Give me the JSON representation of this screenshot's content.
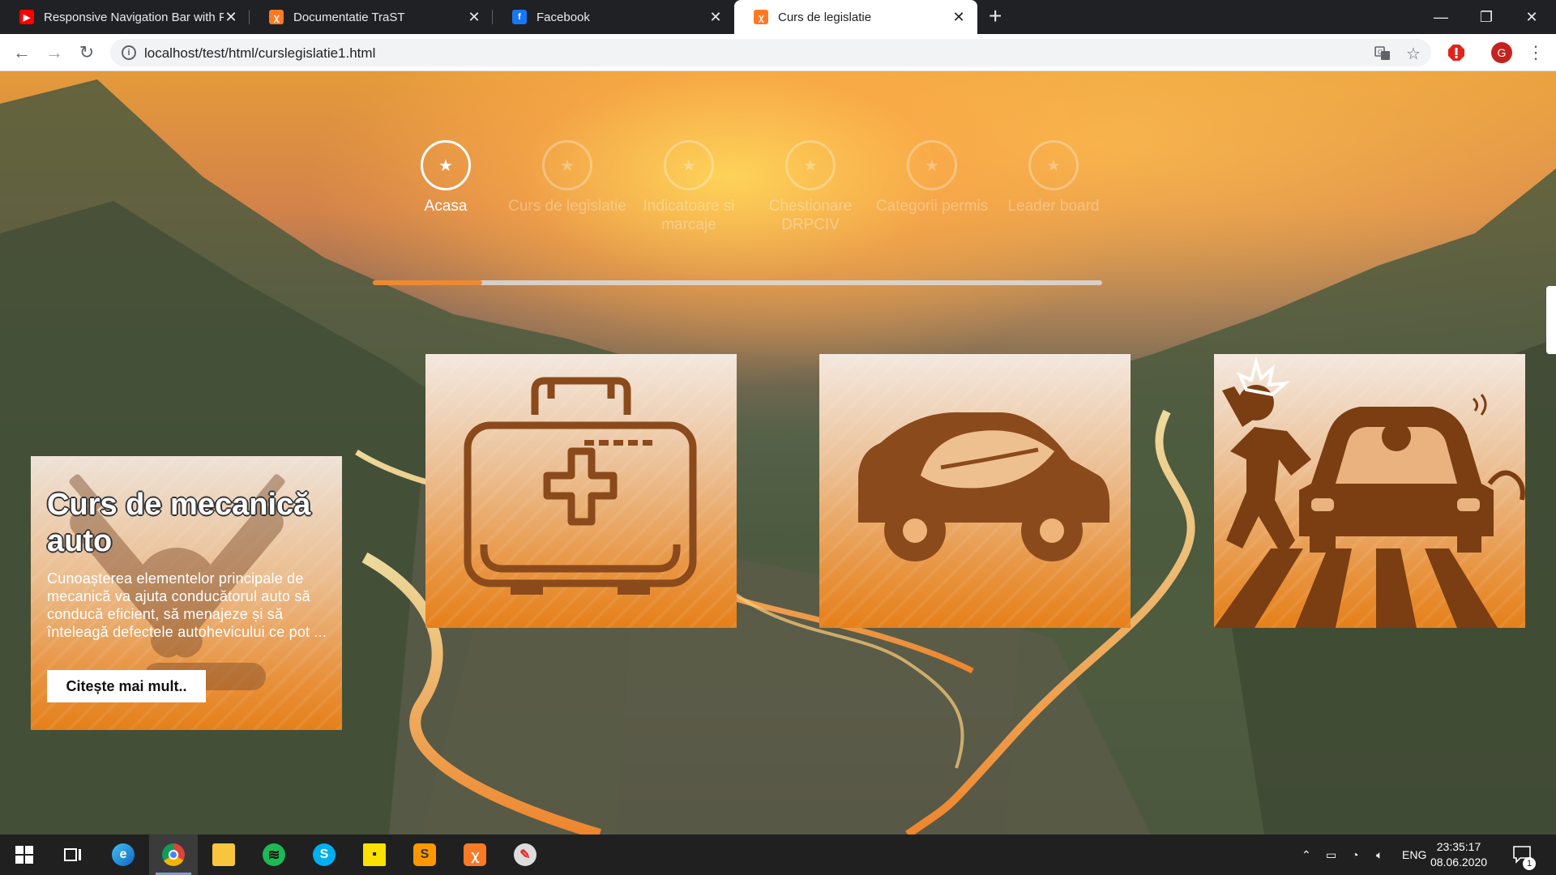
{
  "browser": {
    "tabs": [
      {
        "title": "Responsive Navigation Bar with F",
        "favicon": "youtube-icon"
      },
      {
        "title": "Documentatie TraST",
        "favicon": "xampp-icon"
      },
      {
        "title": "Facebook",
        "favicon": "facebook-icon"
      },
      {
        "title": "Curs de legislatie",
        "favicon": "xampp-icon",
        "active": true
      }
    ],
    "url": "localhost/test/html/curslegislatie1.html",
    "profile_initial": "G"
  },
  "steps": [
    {
      "label": "Acasa",
      "active": true
    },
    {
      "label": "Curs de legislatie",
      "active": false
    },
    {
      "label": "Indicatoare si marcaje",
      "active": false
    },
    {
      "label": "Chestionare DRPCIV",
      "active": false
    },
    {
      "label": "Categorii permis",
      "active": false
    },
    {
      "label": "Leader board",
      "active": false
    }
  ],
  "progress": {
    "fraction": 0.15
  },
  "featured": {
    "title": "Curs de mecanică auto",
    "text": "Cunoașterea elementelor principale de mecanică va ajuta conducătorul auto să conducă eficient, să menajeze și să înteleagă defectele autohevicului ce pot ...",
    "button": "Citește mai mult..",
    "icon": "wrench-plug-icon"
  },
  "cards": [
    {
      "icon": "first-aid-kit-icon"
    },
    {
      "icon": "eco-car-icon"
    },
    {
      "icon": "pedestrian-accident-icon"
    }
  ],
  "colors": {
    "accent": "#ec8a32",
    "card_bottom": "#e5801a",
    "icon_brown": "#8b4513"
  },
  "taskbar": {
    "apps": [
      "windows-start-icon",
      "task-view-icon",
      "edge-icon",
      "chrome-icon",
      "file-explorer-icon",
      "spotify-icon",
      "skype-icon",
      "sticky-notes-icon",
      "sublime-text-icon",
      "xampp-icon",
      "paint-icon"
    ],
    "language": "ENG",
    "time": "23:35:17",
    "date": "08.06.2020",
    "notifications": "1"
  }
}
